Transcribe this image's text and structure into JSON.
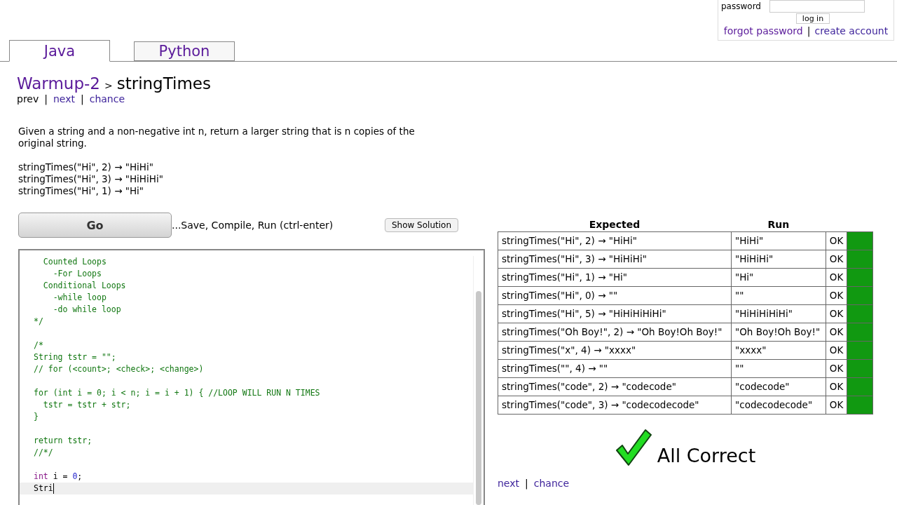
{
  "login": {
    "password_label": "password",
    "button": "log in",
    "forgot": "forgot password",
    "separator": "|",
    "create": "create account"
  },
  "tabs": [
    {
      "label": "Java",
      "selected": true
    },
    {
      "label": "Python",
      "selected": false
    }
  ],
  "breadcrumb": {
    "section": "Warmup-2",
    "arrow": ">",
    "title": "stringTimes"
  },
  "nav": [
    {
      "label": "prev",
      "link": false
    },
    {
      "label": "|",
      "link": false
    },
    {
      "label": "next",
      "link": true
    },
    {
      "label": "|",
      "link": false
    },
    {
      "label": "chance",
      "link": true
    }
  ],
  "description": "Given a string and a non-negative int n, return a larger string that is n copies of the original string.",
  "examples": [
    "stringTimes(\"Hi\", 2) → \"HiHi\"",
    "stringTimes(\"Hi\", 3) → \"HiHiHi\"",
    "stringTimes(\"Hi\", 1) → \"Hi\""
  ],
  "go_button": "Go",
  "go_hint": "...Save, Compile, Run (ctrl-enter)",
  "solution_button": "Show Solution",
  "editor": {
    "lines": [
      {
        "current": false,
        "tokens": [
          {
            "kind": "comment",
            "text": "  Counted Loops"
          }
        ]
      },
      {
        "current": false,
        "tokens": [
          {
            "kind": "comment",
            "text": "    -For Loops"
          }
        ]
      },
      {
        "current": false,
        "tokens": [
          {
            "kind": "comment",
            "text": "  Conditional Loops"
          }
        ]
      },
      {
        "current": false,
        "tokens": [
          {
            "kind": "comment",
            "text": "    -while loop"
          }
        ]
      },
      {
        "current": false,
        "tokens": [
          {
            "kind": "comment",
            "text": "    -do while loop"
          }
        ]
      },
      {
        "current": false,
        "tokens": [
          {
            "kind": "comment",
            "text": "*/"
          }
        ]
      },
      {
        "current": false
      },
      {
        "current": false,
        "tokens": [
          {
            "kind": "comment",
            "text": "/*"
          }
        ]
      },
      {
        "current": false,
        "tokens": [
          {
            "kind": "comment",
            "text": "String tstr = \"\";"
          }
        ]
      },
      {
        "current": false,
        "tokens": [
          {
            "kind": "comment",
            "text": "// for (<count>; <check>; <change>)"
          }
        ]
      },
      {
        "current": false
      },
      {
        "current": false,
        "tokens": [
          {
            "kind": "comment",
            "text": "for (int i = 0; i < n; i = i + 1) { //LOOP WILL RUN N TIMES"
          }
        ]
      },
      {
        "current": false,
        "tokens": [
          {
            "kind": "comment",
            "text": "  tstr = tstr + str;"
          }
        ]
      },
      {
        "current": false,
        "tokens": [
          {
            "kind": "comment",
            "text": "}"
          }
        ]
      },
      {
        "current": false
      },
      {
        "current": false,
        "tokens": [
          {
            "kind": "comment",
            "text": "return tstr;"
          }
        ]
      },
      {
        "current": false,
        "tokens": [
          {
            "kind": "comment",
            "text": "//*/"
          }
        ]
      },
      {
        "current": false
      },
      {
        "current": false,
        "tokens": [
          {
            "kind": "keyword",
            "text": "int"
          },
          {
            "kind": "plain",
            "text": " i = "
          },
          {
            "kind": "number",
            "text": "0"
          },
          {
            "kind": "plain",
            "text": ";"
          }
        ]
      },
      {
        "current": true,
        "tokens": [
          {
            "kind": "plain",
            "text": "Stri"
          }
        ]
      }
    ]
  },
  "results": {
    "columns": [
      "Expected",
      "Run"
    ],
    "rows": [
      {
        "expected": "stringTimes(\"Hi\", 2) → \"HiHi\"",
        "run": "\"HiHi\"",
        "status": "OK",
        "passed": true
      },
      {
        "expected": "stringTimes(\"Hi\", 3) → \"HiHiHi\"",
        "run": "\"HiHiHi\"",
        "status": "OK",
        "passed": true
      },
      {
        "expected": "stringTimes(\"Hi\", 1) → \"Hi\"",
        "run": "\"Hi\"",
        "status": "OK",
        "passed": true
      },
      {
        "expected": "stringTimes(\"Hi\", 0) → \"\"",
        "run": "\"\"",
        "status": "OK",
        "passed": true
      },
      {
        "expected": "stringTimes(\"Hi\", 5) → \"HiHiHiHiHi\"",
        "run": "\"HiHiHiHiHi\"",
        "status": "OK",
        "passed": true
      },
      {
        "expected": "stringTimes(\"Oh Boy!\", 2) → \"Oh Boy!Oh Boy!\"",
        "run": "\"Oh Boy!Oh Boy!\"",
        "status": "OK",
        "passed": true
      },
      {
        "expected": "stringTimes(\"x\", 4) → \"xxxx\"",
        "run": "\"xxxx\"",
        "status": "OK",
        "passed": true
      },
      {
        "expected": "stringTimes(\"\", 4) → \"\"",
        "run": "\"\"",
        "status": "OK",
        "passed": true
      },
      {
        "expected": "stringTimes(\"code\", 2) → \"codecode\"",
        "run": "\"codecode\"",
        "status": "OK",
        "passed": true
      },
      {
        "expected": "stringTimes(\"code\", 3) → \"codecodecode\"",
        "run": "\"codecodecode\"",
        "status": "OK",
        "passed": true
      }
    ]
  },
  "verdict": "All Correct",
  "bottom_nav": [
    {
      "label": "next",
      "link": true
    },
    {
      "label": "|",
      "link": false
    },
    {
      "label": "chance",
      "link": true
    }
  ]
}
